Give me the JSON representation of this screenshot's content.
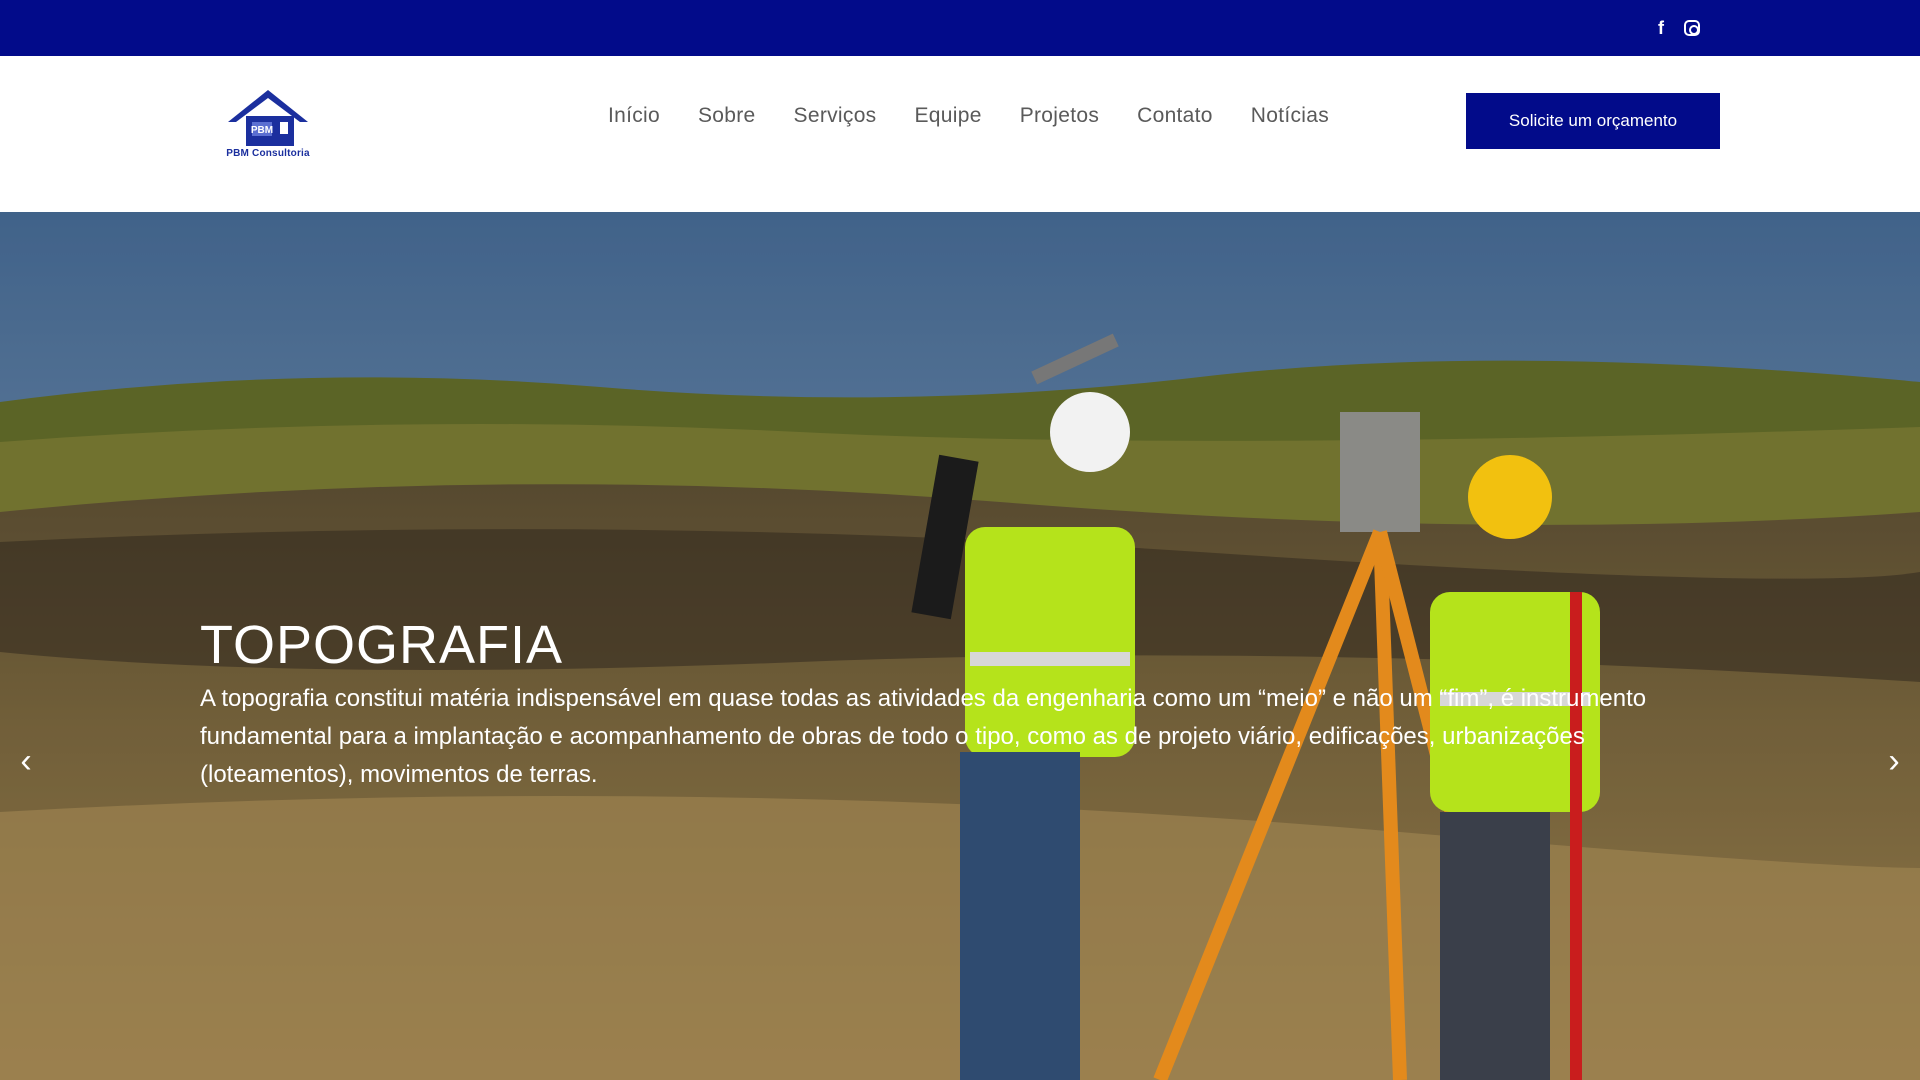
{
  "topbar": {
    "social": [
      {
        "icon": "facebook-icon",
        "glyph": "f"
      },
      {
        "icon": "instagram-icon",
        "glyph": ""
      }
    ]
  },
  "header": {
    "logo_text": "PBM Consultoria",
    "nav": [
      "Início",
      "Sobre",
      "Serviços",
      "Equipe",
      "Projetos",
      "Contato",
      "Notícias"
    ],
    "cta_label": "Solicite um orçamento"
  },
  "hero": {
    "title": "TOPOGRAFIA",
    "text": "A topografia constitui matéria indispensável em quase todas as atividades da engenharia como um “meio” e não um “fim”, é instrumento fundamental para a implantação e acompanhamento de obras de todo o tipo, como as de projeto viário, edificações, urbanizações (loteamentos), movimentos de terras.",
    "prev_icon": "chevron-left-icon",
    "next_icon": "chevron-right-icon"
  },
  "colors": {
    "brand_blue": "#020b8a",
    "nav_text": "#5a5a5a"
  }
}
